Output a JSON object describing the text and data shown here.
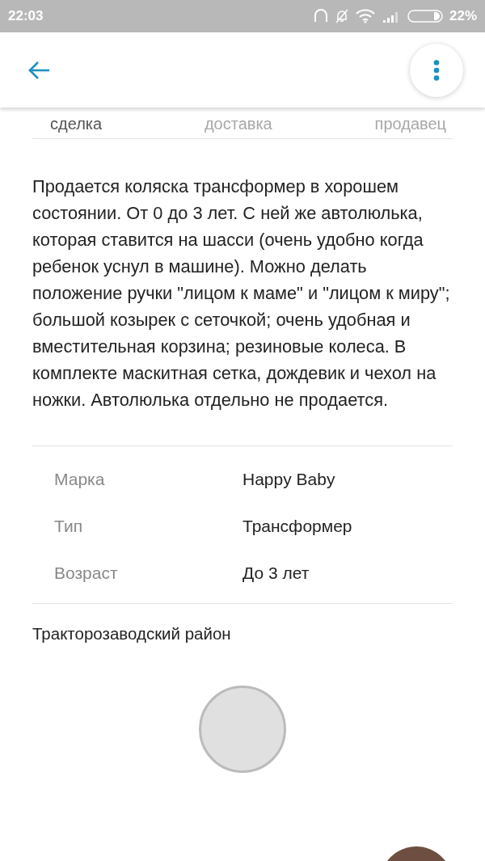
{
  "status_bar": {
    "time": "22:03",
    "battery_percent": "22%"
  },
  "tabs": [
    {
      "label": "сделка",
      "selected": true
    },
    {
      "label": "доставка",
      "selected": false
    },
    {
      "label": "продавец",
      "selected": false
    }
  ],
  "description": "Продается коляска трансформер в хорошем состоянии. От 0 до 3 лет. С ней же автолюлька, которая ставится на шасси (очень удобно когда ребенок уснул в машине). Можно делать положение ручки \"лицом к маме\" и \"лицом к миру\"; большой козырек с сеточкой; очень удобная и вместительная корзина; резиновые колеса. В комплекте маскитная сетка, дождевик и чехол на ножки. Автолюлька отдельно не продается.",
  "attributes": [
    {
      "label": "Марка",
      "value": "Happy Baby"
    },
    {
      "label": "Тип",
      "value": "Трансформер"
    },
    {
      "label": "Возраст",
      "value": "До 3 лет"
    }
  ],
  "location": "Тракторозаводский район"
}
